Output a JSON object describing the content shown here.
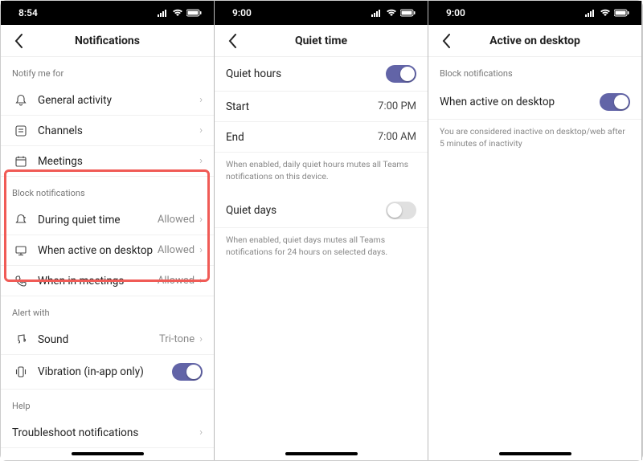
{
  "status": {
    "time1": "8:54",
    "time2": "9:00",
    "time3": "9:00"
  },
  "p1": {
    "title": "Notifications",
    "section_notify": "Notify me for",
    "general": "General activity",
    "channels": "Channels",
    "meetings": "Meetings",
    "section_block": "Block notifications",
    "quiet": "During quiet time",
    "desktop": "When active on desktop",
    "inmeet": "When in meetings",
    "allowed": "Allowed",
    "section_alert": "Alert with",
    "sound": "Sound",
    "sound_val": "Tri-tone",
    "vibration": "Vibration (in-app only)",
    "section_help": "Help",
    "troubleshoot": "Troubleshoot notifications"
  },
  "p2": {
    "title": "Quiet time",
    "quiet_hours": "Quiet hours",
    "start": "Start",
    "start_val": "7:00 PM",
    "end": "End",
    "end_val": "7:00 AM",
    "note1": "When enabled, daily quiet hours mutes all Teams notifications on this device.",
    "quiet_days": "Quiet days",
    "note2": "When enabled, quiet days mutes all Teams notifications for 24 hours on selected days."
  },
  "p3": {
    "title": "Active on desktop",
    "section": "Block notifications",
    "row": "When active on desktop",
    "note": "You are considered inactive on desktop/web after 5 minutes of inactivity"
  }
}
